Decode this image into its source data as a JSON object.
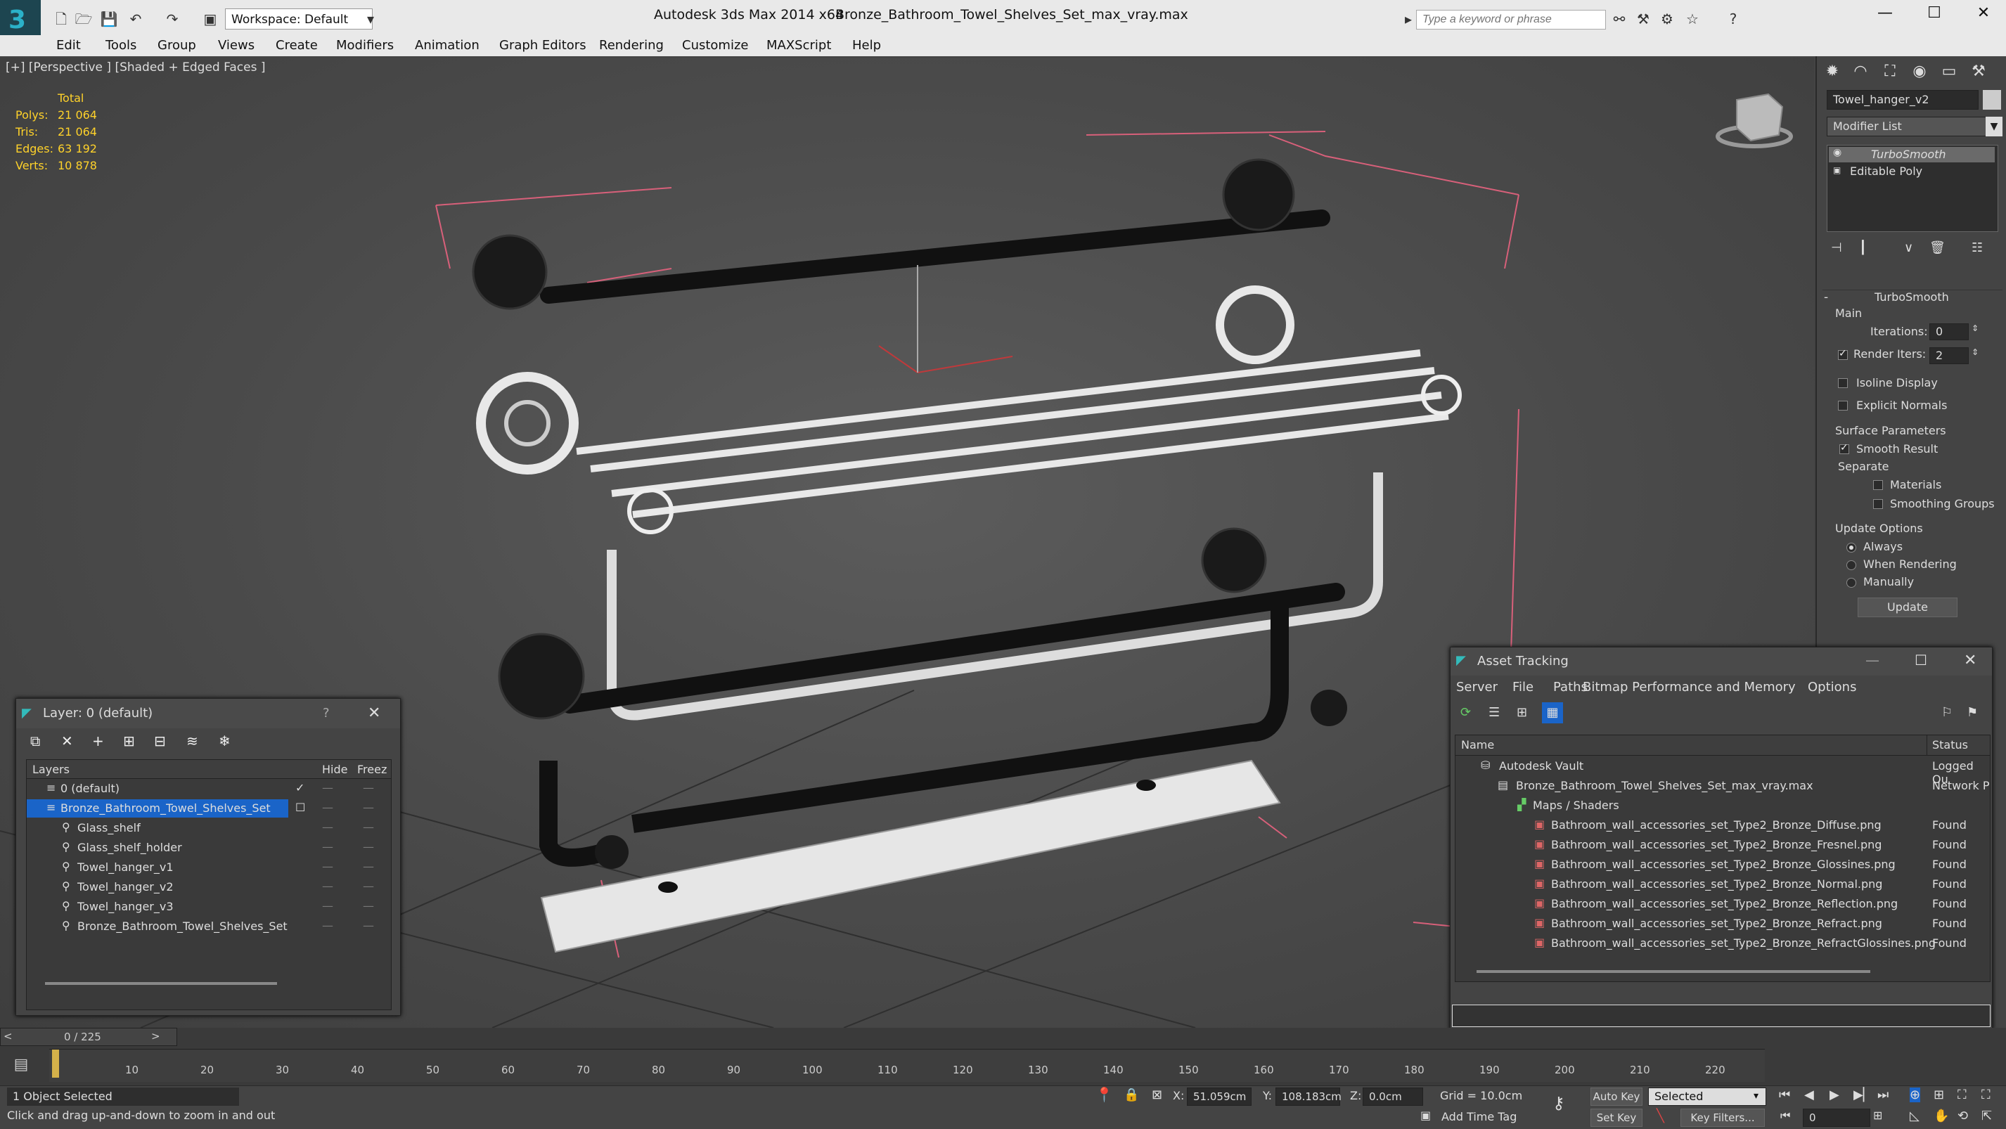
{
  "app": {
    "title": "Autodesk 3ds Max  2014 x64",
    "file_title": "Bronze_Bathroom_Towel_Shelves_Set_max_vray.max",
    "workspace": "Workspace: Default",
    "search_placeholder": "Type a keyword or phrase"
  },
  "menu": [
    "Edit",
    "Tools",
    "Group",
    "Views",
    "Create",
    "Modifiers",
    "Animation",
    "Graph Editors",
    "Rendering",
    "Customize",
    "MAXScript",
    "Help"
  ],
  "viewport": {
    "label": "[+] [Perspective ] [Shaded + Edged Faces ]",
    "stats": {
      "header": "Total",
      "rows": [
        {
          "label": "Polys:",
          "value": "21 064"
        },
        {
          "label": "Tris:",
          "value": "21 064"
        },
        {
          "label": "Edges:",
          "value": "63 192"
        },
        {
          "label": "Verts:",
          "value": "10 878"
        }
      ]
    }
  },
  "command_panel": {
    "object_name": "Towel_hanger_v2",
    "modifier_list": "Modifier List",
    "stack": [
      "TurboSmooth",
      "Editable Poly"
    ],
    "rollout_title": "TurboSmooth",
    "main_label": "Main",
    "iterations_label": "Iterations:",
    "iterations_value": "0",
    "render_iters_label": "Render Iters:",
    "render_iters_value": "2",
    "isoline_label": "Isoline Display",
    "explicit_normals_label": "Explicit Normals",
    "surface_params_label": "Surface Parameters",
    "smooth_result_label": "Smooth Result",
    "separate_label": "Separate",
    "materials_label": "Materials",
    "smoothing_groups_label": "Smoothing Groups",
    "update_options_label": "Update Options",
    "always_label": "Always",
    "when_rendering_label": "When Rendering",
    "manually_label": "Manually",
    "update_button": "Update"
  },
  "layer_dialog": {
    "title": "Layer: 0 (default)",
    "help": "?",
    "columns": {
      "layers": "Layers",
      "hide": "Hide",
      "freeze": "Freez"
    },
    "rows": [
      {
        "name": "0 (default)",
        "level": 1
      },
      {
        "name": "Bronze_Bathroom_Towel_Shelves_Set",
        "level": 1
      },
      {
        "name": "Glass_shelf",
        "level": 2
      },
      {
        "name": "Glass_shelf_holder",
        "level": 2
      },
      {
        "name": "Towel_hanger_v1",
        "level": 2
      },
      {
        "name": "Towel_hanger_v2",
        "level": 2
      },
      {
        "name": "Towel_hanger_v3",
        "level": 2
      },
      {
        "name": "Bronze_Bathroom_Towel_Shelves_Set",
        "level": 2
      }
    ]
  },
  "asset_dialog": {
    "title": "Asset Tracking",
    "menu": [
      "Server",
      "File",
      "Paths",
      "Bitmap Performance and Memory",
      "Options"
    ],
    "col_name": "Name",
    "col_status": "Status",
    "rows": [
      {
        "name": "Autodesk Vault",
        "status": "Logged Ou",
        "level": 1
      },
      {
        "name": "Bronze_Bathroom_Towel_Shelves_Set_max_vray.max",
        "status": "Network P",
        "level": 2
      },
      {
        "name": "Maps / Shaders",
        "status": "",
        "level": 3
      },
      {
        "name": "Bathroom_wall_accessories_set_Type2_Bronze_Diffuse.png",
        "status": "Found",
        "level": 4
      },
      {
        "name": "Bathroom_wall_accessories_set_Type2_Bronze_Fresnel.png",
        "status": "Found",
        "level": 4
      },
      {
        "name": "Bathroom_wall_accessories_set_Type2_Bronze_Glossines.png",
        "status": "Found",
        "level": 4
      },
      {
        "name": "Bathroom_wall_accessories_set_Type2_Bronze_Normal.png",
        "status": "Found",
        "level": 4
      },
      {
        "name": "Bathroom_wall_accessories_set_Type2_Bronze_Reflection.png",
        "status": "Found",
        "level": 4
      },
      {
        "name": "Bathroom_wall_accessories_set_Type2_Bronze_Refract.png",
        "status": "Found",
        "level": 4
      },
      {
        "name": "Bathroom_wall_accessories_set_Type2_Bronze_RefractGlossines.png",
        "status": "Found",
        "level": 4
      }
    ]
  },
  "timeline": {
    "frame": "0 / 225",
    "ticks": [
      "10",
      "20",
      "30",
      "40",
      "50",
      "60",
      "70",
      "80",
      "90",
      "100",
      "110",
      "120",
      "130",
      "140",
      "150",
      "160",
      "170",
      "180",
      "190",
      "200",
      "210",
      "220"
    ]
  },
  "status": {
    "selection": "1 Object Selected",
    "hint": "Click and drag up-and-down to zoom in and out",
    "x_label": "X:",
    "x_value": "51.059cm",
    "y_label": "Y:",
    "y_value": "108.183cm",
    "z_label": "Z:",
    "z_value": "0.0cm",
    "grid": "Grid = 10.0cm",
    "auto_key": "Auto Key",
    "set_key": "Set Key",
    "selected_dropdown": "Selected",
    "key_filters": "Key Filters...",
    "add_time_tag": "Add Time Tag",
    "frame_field": "0"
  }
}
